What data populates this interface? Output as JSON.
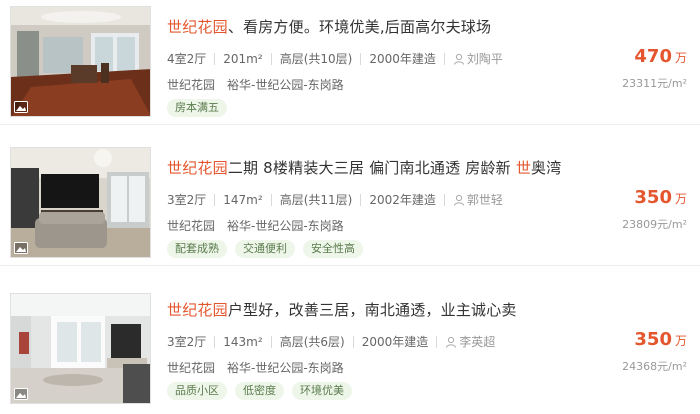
{
  "listings": [
    {
      "title_highlight": "世纪花园",
      "title_rest": "、看房方便。环境优美,后面高尔夫球场",
      "title_highlight2": "",
      "title_rest2": "",
      "layout": "4室2厅",
      "area": "201m²",
      "floor": "高层(共10层)",
      "built": "2000年建造",
      "agent": "刘陶平",
      "community": "世纪花园",
      "district": "裕华-世纪公园-东岗路",
      "tags": [
        "房本满五"
      ],
      "price": "470",
      "price_unit": "万",
      "unit_price": "23311元/m²"
    },
    {
      "title_highlight": "世纪花园",
      "title_rest": "二期 8楼精装大三居 偏门南北通透 房龄新 ",
      "title_highlight2": "世",
      "title_rest2": "奥湾",
      "layout": "3室2厅",
      "area": "147m²",
      "floor": "高层(共11层)",
      "built": "2002年建造",
      "agent": "郭世轻",
      "community": "世纪花园",
      "district": "裕华-世纪公园-东岗路",
      "tags": [
        "配套成熟",
        "交通便利",
        "安全性高"
      ],
      "price": "350",
      "price_unit": "万",
      "unit_price": "23809元/m²"
    },
    {
      "title_highlight": "世纪花园",
      "title_rest": "户型好，改善三居，南北通透，业主诚心卖",
      "title_highlight2": "",
      "title_rest2": "",
      "layout": "3室2厅",
      "area": "143m²",
      "floor": "高层(共6层)",
      "built": "2000年建造",
      "agent": "李英超",
      "community": "世纪花园",
      "district": "裕华-世纪公园-东岗路",
      "tags": [
        "品质小区",
        "低密度",
        "环境优美"
      ],
      "price": "350",
      "price_unit": "万",
      "unit_price": "24368元/m²"
    }
  ],
  "colors": {
    "accent": "#e4572e",
    "tag_bg": "#eef6ea",
    "tag_text": "#5a7b4c"
  },
  "icons": {
    "agent": "user-icon",
    "photo": "image-icon"
  }
}
